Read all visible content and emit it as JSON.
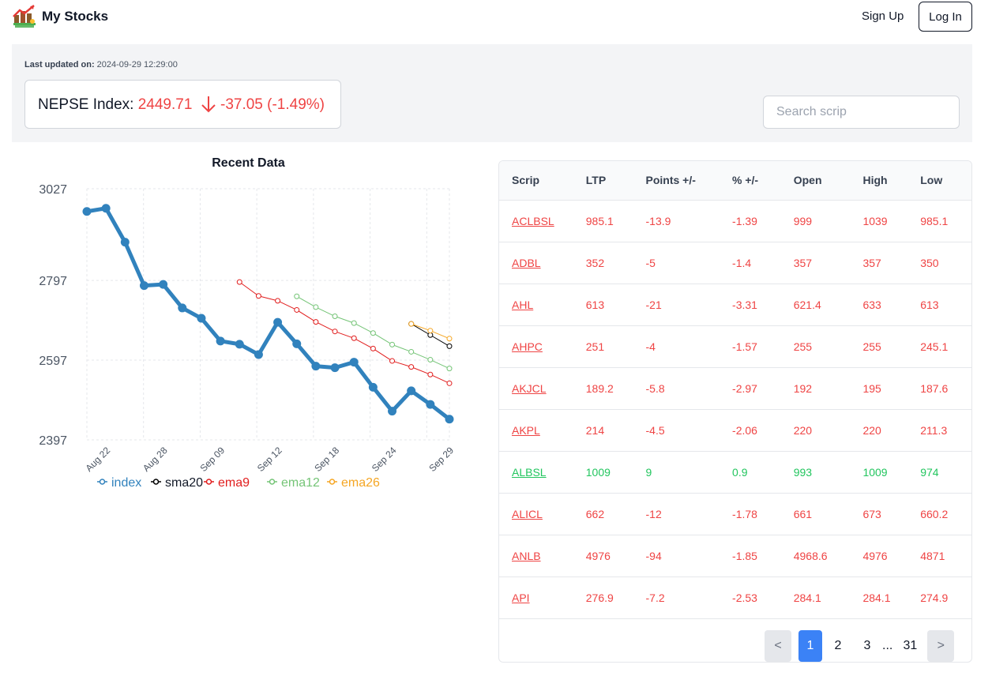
{
  "nav": {
    "brand": "My Stocks",
    "signup": "Sign Up",
    "login": "Log In"
  },
  "summary": {
    "updated_label": "Last updated on:",
    "updated_value": "2024-09-29 12:29:00",
    "index_label": "NEPSE Index:",
    "index_value": "2449.71",
    "index_change": "-37.05 (-1.49%)",
    "search_placeholder": "Search scrip"
  },
  "colors": {
    "down": "#ef4444",
    "up": "#22c55e",
    "index": "#3182bd",
    "sma20": "#000000",
    "ema9": "#e11d1d",
    "ema12": "#74c476",
    "ema26": "#f5a623",
    "accent": "#3b82f6"
  },
  "chart_data": {
    "type": "line",
    "title": "Recent Data",
    "yticks": [
      2397,
      2597,
      2797,
      3027
    ],
    "xticks": [
      "Aug 22",
      "Aug 28",
      "Sep 09",
      "Sep 12",
      "Sep 18",
      "Sep 24",
      "Sep 29"
    ],
    "ylim": [
      2397,
      3027
    ],
    "grid": true,
    "legend_position": "bottom",
    "x": [
      0,
      1,
      2,
      3,
      4,
      5,
      6,
      7,
      8,
      9,
      10,
      11,
      12,
      13,
      14,
      15,
      16,
      17,
      18,
      19
    ],
    "series": [
      {
        "name": "index",
        "color": "#3182bd",
        "values": [
          2970,
          2978,
          2893,
          2784,
          2787,
          2728,
          2702,
          2645,
          2637,
          2611,
          2692,
          2638,
          2582,
          2578,
          2592,
          2529,
          2469,
          2520,
          2486,
          2449
        ]
      },
      {
        "name": "sma20",
        "color": "#000000",
        "values": [
          null,
          null,
          null,
          null,
          null,
          null,
          null,
          null,
          null,
          null,
          null,
          null,
          null,
          null,
          null,
          null,
          null,
          2688,
          2660,
          2632
        ]
      },
      {
        "name": "ema9",
        "color": "#e11d1d",
        "values": [
          null,
          null,
          null,
          null,
          null,
          null,
          null,
          null,
          2793,
          2758,
          2746,
          2723,
          2693,
          2669,
          2652,
          2626,
          2595,
          2580,
          2561,
          2539
        ]
      },
      {
        "name": "ema12",
        "color": "#74c476",
        "values": [
          null,
          null,
          null,
          null,
          null,
          null,
          null,
          null,
          null,
          null,
          null,
          2757,
          2730,
          2707,
          2690,
          2665,
          2636,
          2618,
          2598,
          2576
        ]
      },
      {
        "name": "ema26",
        "color": "#f5a623",
        "values": [
          null,
          null,
          null,
          null,
          null,
          null,
          null,
          null,
          null,
          null,
          null,
          null,
          null,
          null,
          null,
          null,
          null,
          2688,
          2671,
          2651
        ]
      }
    ]
  },
  "table": {
    "headers": [
      "Scrip",
      "LTP",
      "Points +/-",
      "% +/-",
      "Open",
      "High",
      "Low"
    ],
    "rows": [
      {
        "trend": "down",
        "cells": [
          "ACLBSL",
          "985.1",
          "-13.9",
          "-1.39",
          "999",
          "1039",
          "985.1"
        ]
      },
      {
        "trend": "down",
        "cells": [
          "ADBL",
          "352",
          "-5",
          "-1.4",
          "357",
          "357",
          "350"
        ]
      },
      {
        "trend": "down",
        "cells": [
          "AHL",
          "613",
          "-21",
          "-3.31",
          "621.4",
          "633",
          "613"
        ]
      },
      {
        "trend": "down",
        "cells": [
          "AHPC",
          "251",
          "-4",
          "-1.57",
          "255",
          "255",
          "245.1"
        ]
      },
      {
        "trend": "down",
        "cells": [
          "AKJCL",
          "189.2",
          "-5.8",
          "-2.97",
          "192",
          "195",
          "187.6"
        ]
      },
      {
        "trend": "down",
        "cells": [
          "AKPL",
          "214",
          "-4.5",
          "-2.06",
          "220",
          "220",
          "211.3"
        ]
      },
      {
        "trend": "up",
        "cells": [
          "ALBSL",
          "1009",
          "9",
          "0.9",
          "993",
          "1009",
          "974"
        ]
      },
      {
        "trend": "down",
        "cells": [
          "ALICL",
          "662",
          "-12",
          "-1.78",
          "661",
          "673",
          "660.2"
        ]
      },
      {
        "trend": "down",
        "cells": [
          "ANLB",
          "4976",
          "-94",
          "-1.85",
          "4968.6",
          "4976",
          "4871"
        ]
      },
      {
        "trend": "down",
        "cells": [
          "API",
          "276.9",
          "-7.2",
          "-2.53",
          "284.1",
          "284.1",
          "274.9"
        ]
      }
    ]
  },
  "pagination": {
    "prev": "<",
    "pages": [
      "1",
      "2",
      "3"
    ],
    "ellipsis": "...",
    "last": "31",
    "next": ">",
    "current": "1"
  }
}
